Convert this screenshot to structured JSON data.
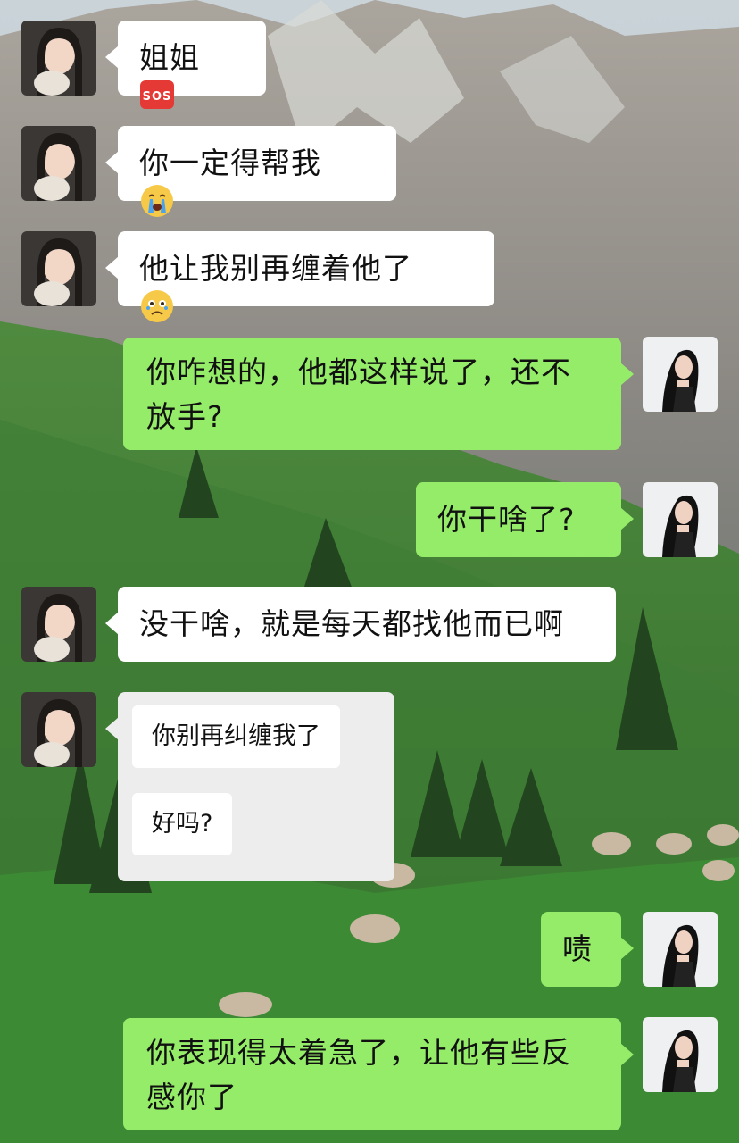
{
  "messages": [
    {
      "id": "m1",
      "side": "left",
      "text": "姐姐",
      "emoji": "sos-icon"
    },
    {
      "id": "m2",
      "side": "left",
      "text": "你一定得帮我",
      "emoji": "crying-face-icon"
    },
    {
      "id": "m3",
      "side": "left",
      "text": "他让我别再缠着他了",
      "emoji": "holding-back-tears-icon"
    },
    {
      "id": "m4",
      "side": "right",
      "text_line1": "你咋想的，他都这样说了，还不",
      "text_line2": "放手?"
    },
    {
      "id": "m5",
      "side": "right",
      "text": "你干啥了?"
    },
    {
      "id": "m6",
      "side": "left",
      "text": "没干啥，就是每天都找他而已啊"
    },
    {
      "id": "m7",
      "side": "left",
      "type": "quoted-card",
      "lines": [
        "你别再纠缠我了",
        "好吗?"
      ]
    },
    {
      "id": "m8",
      "side": "right",
      "text": "啧"
    },
    {
      "id": "m9",
      "side": "right",
      "text_line1": "你表现得太着急了，让他有些反",
      "text_line2": "感你了"
    }
  ],
  "emoji_labels": {
    "sos": "SOS"
  },
  "colors": {
    "my_bubble": "#95ec69",
    "their_bubble": "#ffffff",
    "card": "#ededed"
  }
}
